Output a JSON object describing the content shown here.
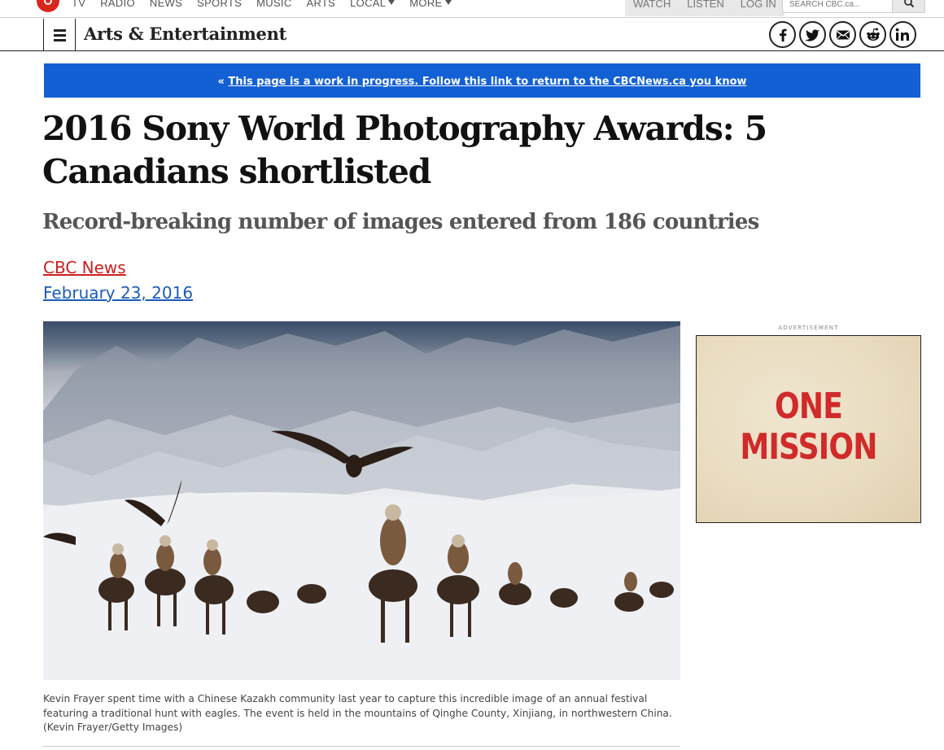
{
  "topnav": {
    "links": [
      "TV",
      "RADIO",
      "NEWS",
      "SPORTS",
      "MUSIC",
      "ARTS",
      "LOCAL",
      "MORE"
    ],
    "utility": [
      "WATCH",
      "LISTEN",
      "LOG IN"
    ],
    "search_placeholder": "SEARCH CBC.ca..."
  },
  "section": {
    "title": "Arts & Entertainment"
  },
  "social": [
    "facebook-icon",
    "twitter-icon",
    "email-icon",
    "reddit-icon",
    "linkedin-icon"
  ],
  "banner": {
    "quote": "« ",
    "link_text": "This page is a work in progress. Follow this link to return to the CBCNews.ca you know"
  },
  "article": {
    "headline": "2016 Sony World Photography Awards: 5 Canadians shortlisted",
    "deck": "Record-breaking number of images entered from 186 countries",
    "byline": "CBC News",
    "date": "February 23, 2016",
    "caption": "Kevin Frayer spent time with a Chinese Kazakh community last year to capture this incredible image of an annual festival featuring a traditional hunt with eagles. The event is held in the mountains of Qinghe County, Xinjiang, in northwestern China. (Kevin Frayer/Getty Images)"
  },
  "ad": {
    "label": "ADVERTISEMENT",
    "line1": "ONE",
    "line2": "MISSION"
  },
  "colors": {
    "brand_red": "#cc1f1f",
    "banner_blue": "#1360d4",
    "date_blue": "#1c5bb8",
    "ad_red": "#d02a2a"
  }
}
